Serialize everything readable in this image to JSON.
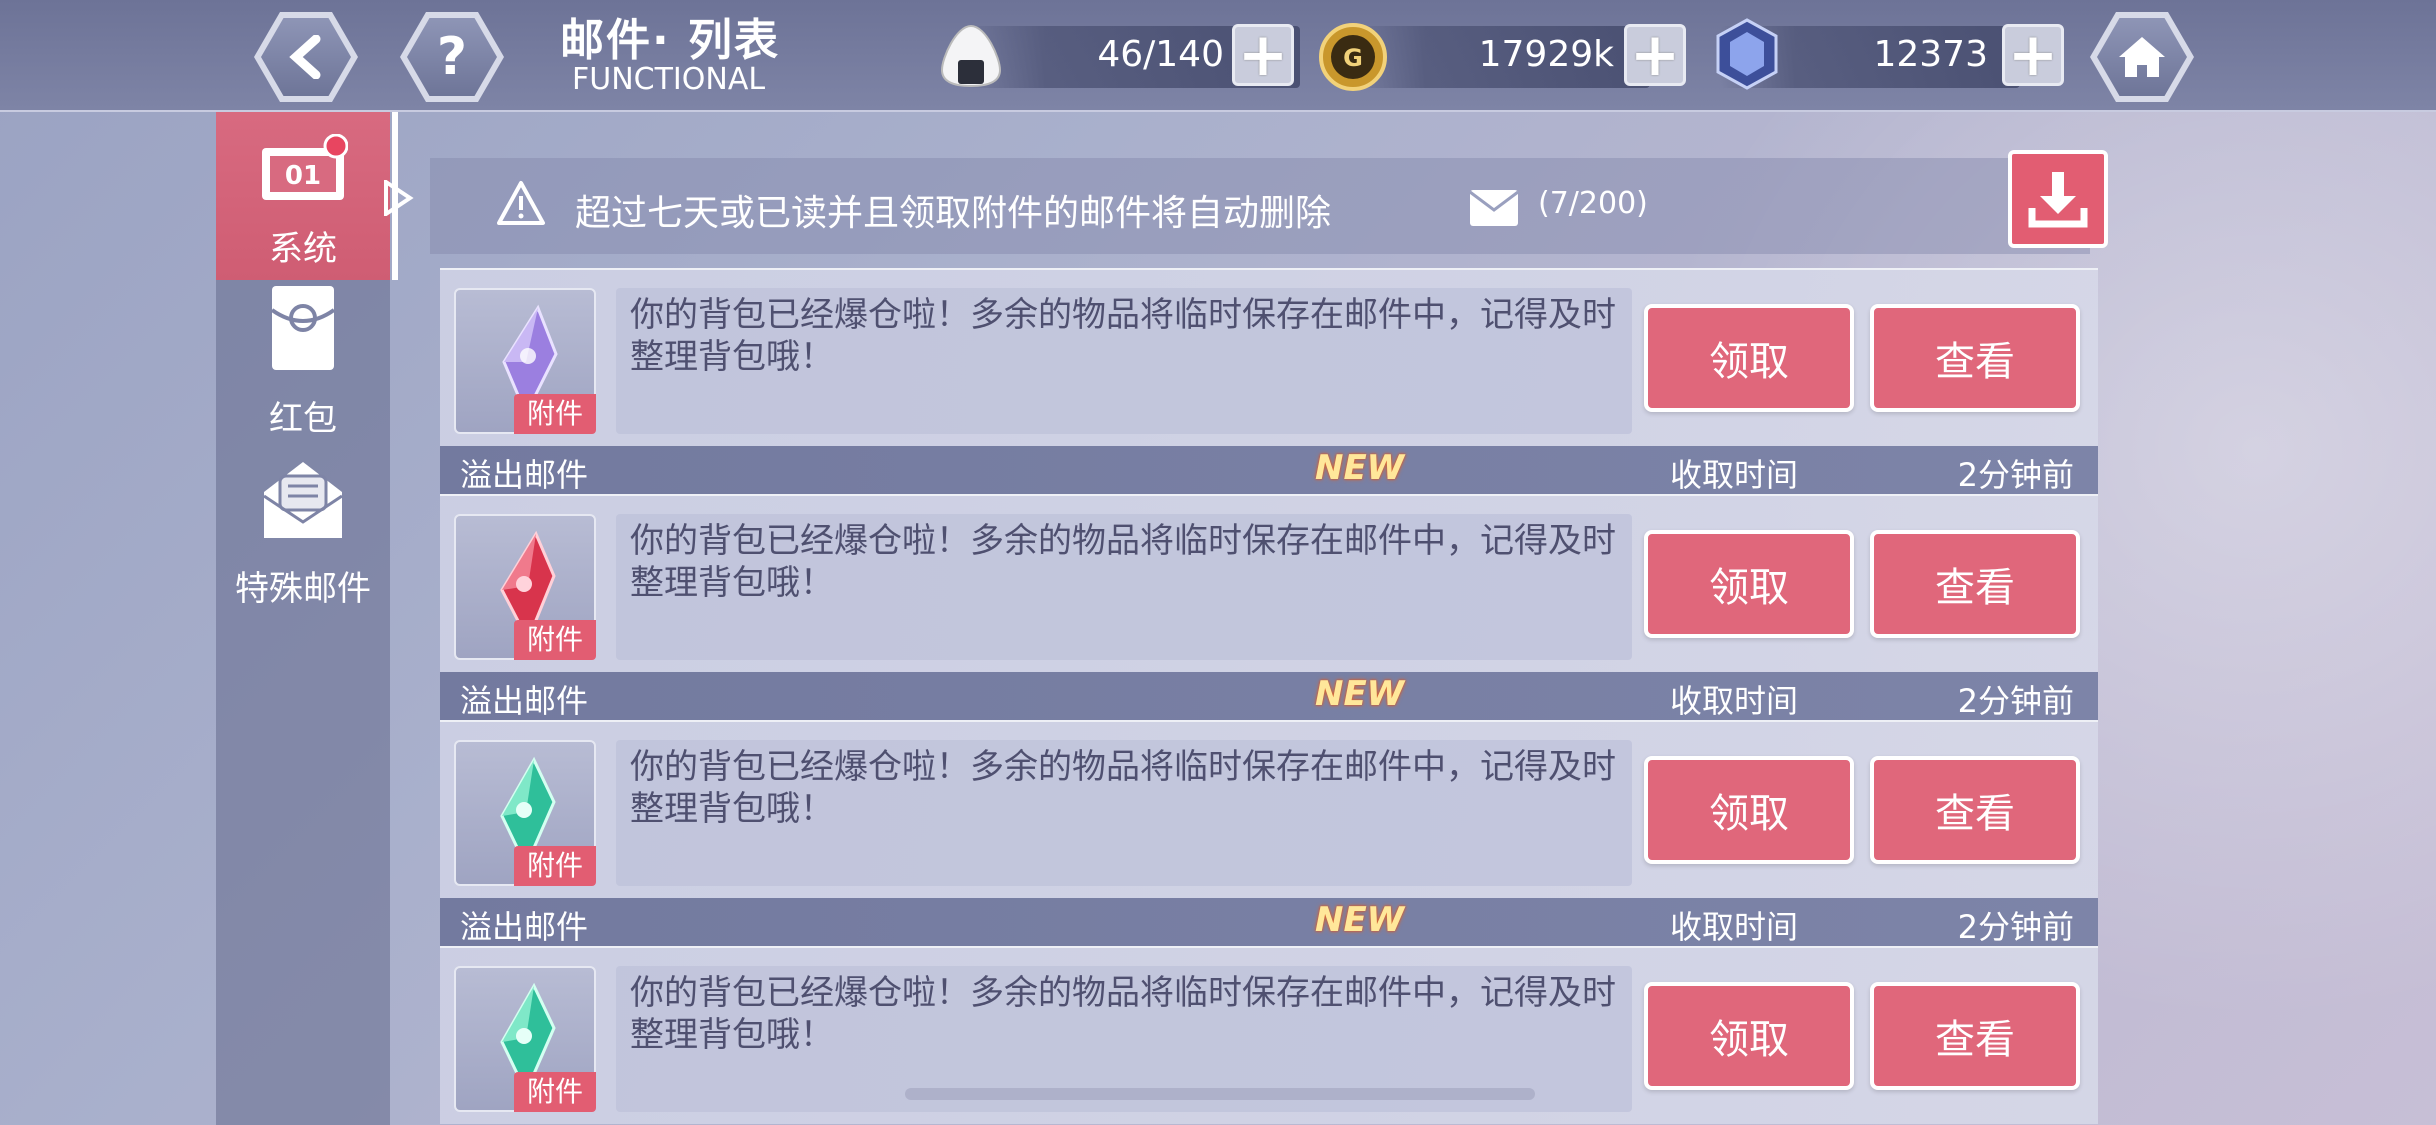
{
  "header": {
    "title": "邮件· 列表",
    "subtitle": "FUNCTIONAL"
  },
  "resources": {
    "stamina": "46/140",
    "coins": "17929k",
    "gems": "12373"
  },
  "sidebar": {
    "items": [
      {
        "label": "系统",
        "icon": "system-mail-icon"
      },
      {
        "label": "红包",
        "icon": "red-envelope-icon"
      },
      {
        "label": "特殊邮件",
        "icon": "special-mail-icon"
      }
    ]
  },
  "notice": {
    "text": "超过七天或已读并且领取附件的邮件将自动删除",
    "count": "(7/200)"
  },
  "mails": [
    {
      "type": "",
      "message": "你的背包已经爆仓啦！多余的物品将临时保存在邮件中，记得及时整理背包哦！",
      "tag": "附件",
      "claim": "领取",
      "view": "查看",
      "crystal": "#9b7fe0"
    },
    {
      "type": "溢出邮件",
      "new": "NEW",
      "time_label": "收取时间",
      "time": "2分钟前",
      "message": "你的背包已经爆仓啦！多余的物品将临时保存在邮件中，记得及时整理背包哦！",
      "tag": "附件",
      "claim": "领取",
      "view": "查看",
      "crystal": "#d8344c"
    },
    {
      "type": "溢出邮件",
      "new": "NEW",
      "time_label": "收取时间",
      "time": "2分钟前",
      "message": "你的背包已经爆仓啦！多余的物品将临时保存在邮件中，记得及时整理背包哦！",
      "tag": "附件",
      "claim": "领取",
      "view": "查看",
      "crystal": "#2fbf9a"
    },
    {
      "type": "溢出邮件",
      "new": "NEW",
      "time_label": "收取时间",
      "time": "2分钟前",
      "message": "你的背包已经爆仓啦！多余的物品将临时保存在邮件中，记得及时整理背包哦！",
      "tag": "附件",
      "claim": "领取",
      "view": "查看",
      "crystal": "#2fbf9a"
    }
  ]
}
